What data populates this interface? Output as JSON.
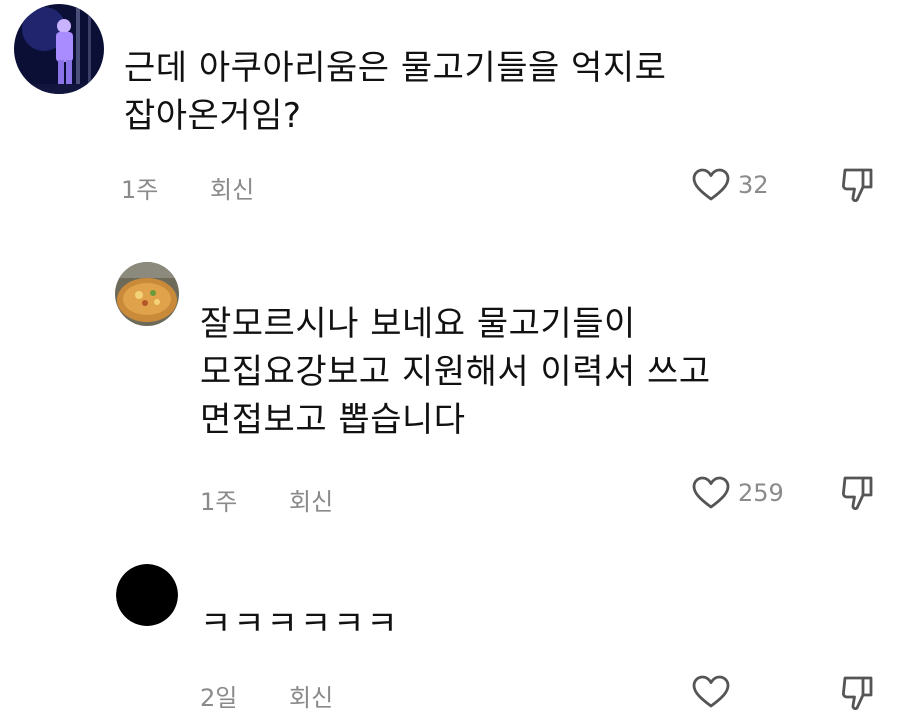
{
  "comments": [
    {
      "text": "근데 아쿠아리움은 물고기들을 억지로\n잡아온거임?",
      "time": "1주",
      "reply_label": "회신",
      "likes": "32",
      "avatar_icon": "user-avatar-performer"
    },
    {
      "text": "잘모르시나 보네요 물고기들이\n모집요강보고 지원해서 이력서 쓰고\n면접보고 뽑습니다",
      "time": "1주",
      "reply_label": "회신",
      "likes": "259",
      "avatar_icon": "user-avatar-food"
    },
    {
      "text": "ㅋㅋㅋㅋㅋㅋ",
      "time": "2일",
      "reply_label": "회신",
      "likes": "",
      "avatar_icon": "user-avatar-black"
    }
  ],
  "icons": {
    "like": "heart-icon",
    "dislike": "thumbs-down-icon"
  },
  "colors": {
    "meta": "#8a8a8a",
    "text": "#111111",
    "background": "#ffffff"
  }
}
